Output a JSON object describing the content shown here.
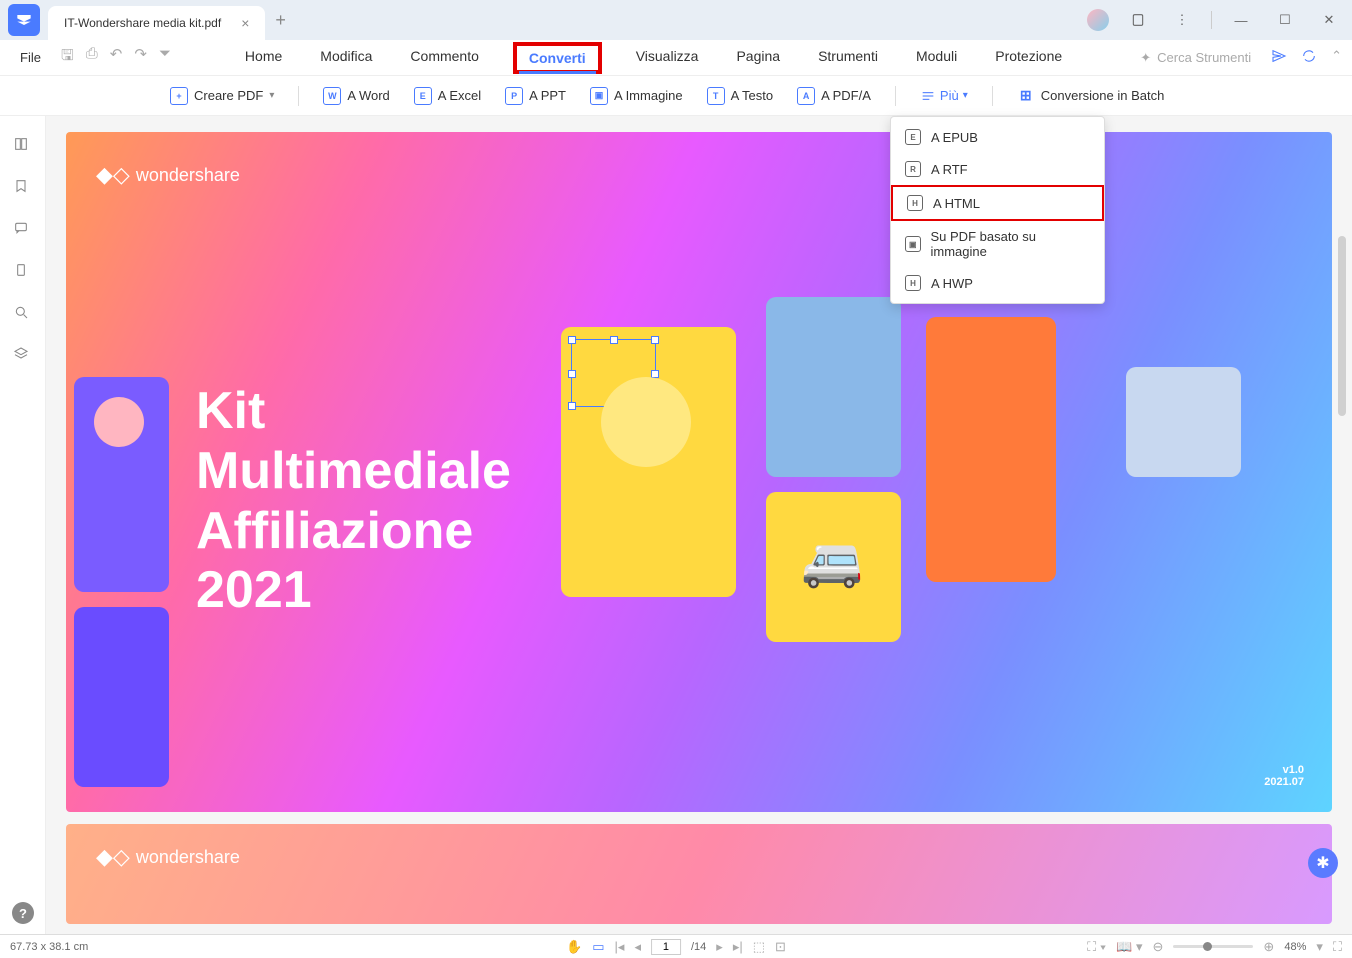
{
  "titlebar": {
    "tab_name": "IT-Wondershare media kit.pdf"
  },
  "menubar": {
    "file": "File",
    "tabs": [
      "Home",
      "Modifica",
      "Commento",
      "Converti",
      "Visualizza",
      "Pagina",
      "Strumenti",
      "Moduli",
      "Protezione"
    ],
    "active_tab": "Converti",
    "search_placeholder": "Cerca Strumenti"
  },
  "toolbar": {
    "create": "Creare PDF",
    "word": "A Word",
    "excel": "A Excel",
    "ppt": "A PPT",
    "image": "A Immagine",
    "text": "A Testo",
    "pdfa": "A PDF/A",
    "more": "Più",
    "batch": "Conversione in Batch"
  },
  "dropdown": {
    "epub": "A EPUB",
    "rtf": "A RTF",
    "html": "A HTML",
    "img_pdf": "Su PDF basato su immagine",
    "hwp": "A HWP"
  },
  "document": {
    "brand": "wondershare",
    "title_l1": "Kit",
    "title_l2": "Multimediale",
    "title_l3": "Affiliazione",
    "title_l4": "2021",
    "version": "v1.0",
    "date": "2021.07"
  },
  "statusbar": {
    "dimensions": "67.73 x 38.1 cm",
    "page_current": "1",
    "page_total": "/14",
    "zoom": "48%"
  }
}
